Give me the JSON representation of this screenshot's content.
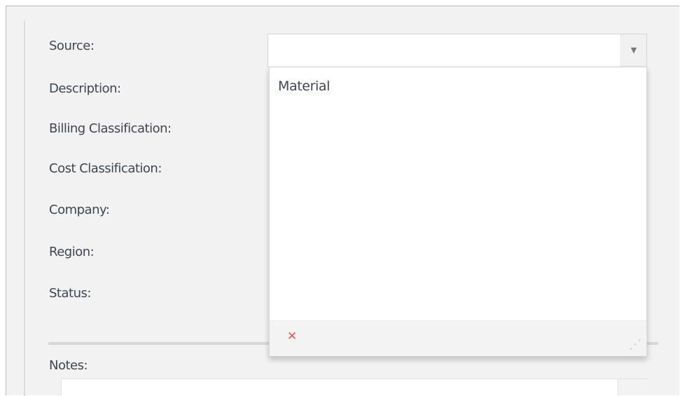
{
  "form": {
    "labels": {
      "source": "Source:",
      "description": "Description:",
      "billing_classification": "Billing Classification:",
      "cost_classification": "Cost Classification:",
      "company": "Company:",
      "region": "Region:",
      "status": "Status:",
      "notes": "Notes:"
    },
    "source_field": {
      "value": "",
      "arrow_icon": "chevron-down-icon"
    },
    "dropdown": {
      "options": [
        "Material"
      ],
      "clear_icon": "clear-icon",
      "resize_icon": "resize-handle-icon"
    },
    "notes_field": {
      "value": ""
    }
  },
  "colors": {
    "panel_background": "#f2f2f2",
    "label_text": "#3d4652",
    "input_border": "#d4d4d4",
    "clear_icon": "#e4545f"
  }
}
